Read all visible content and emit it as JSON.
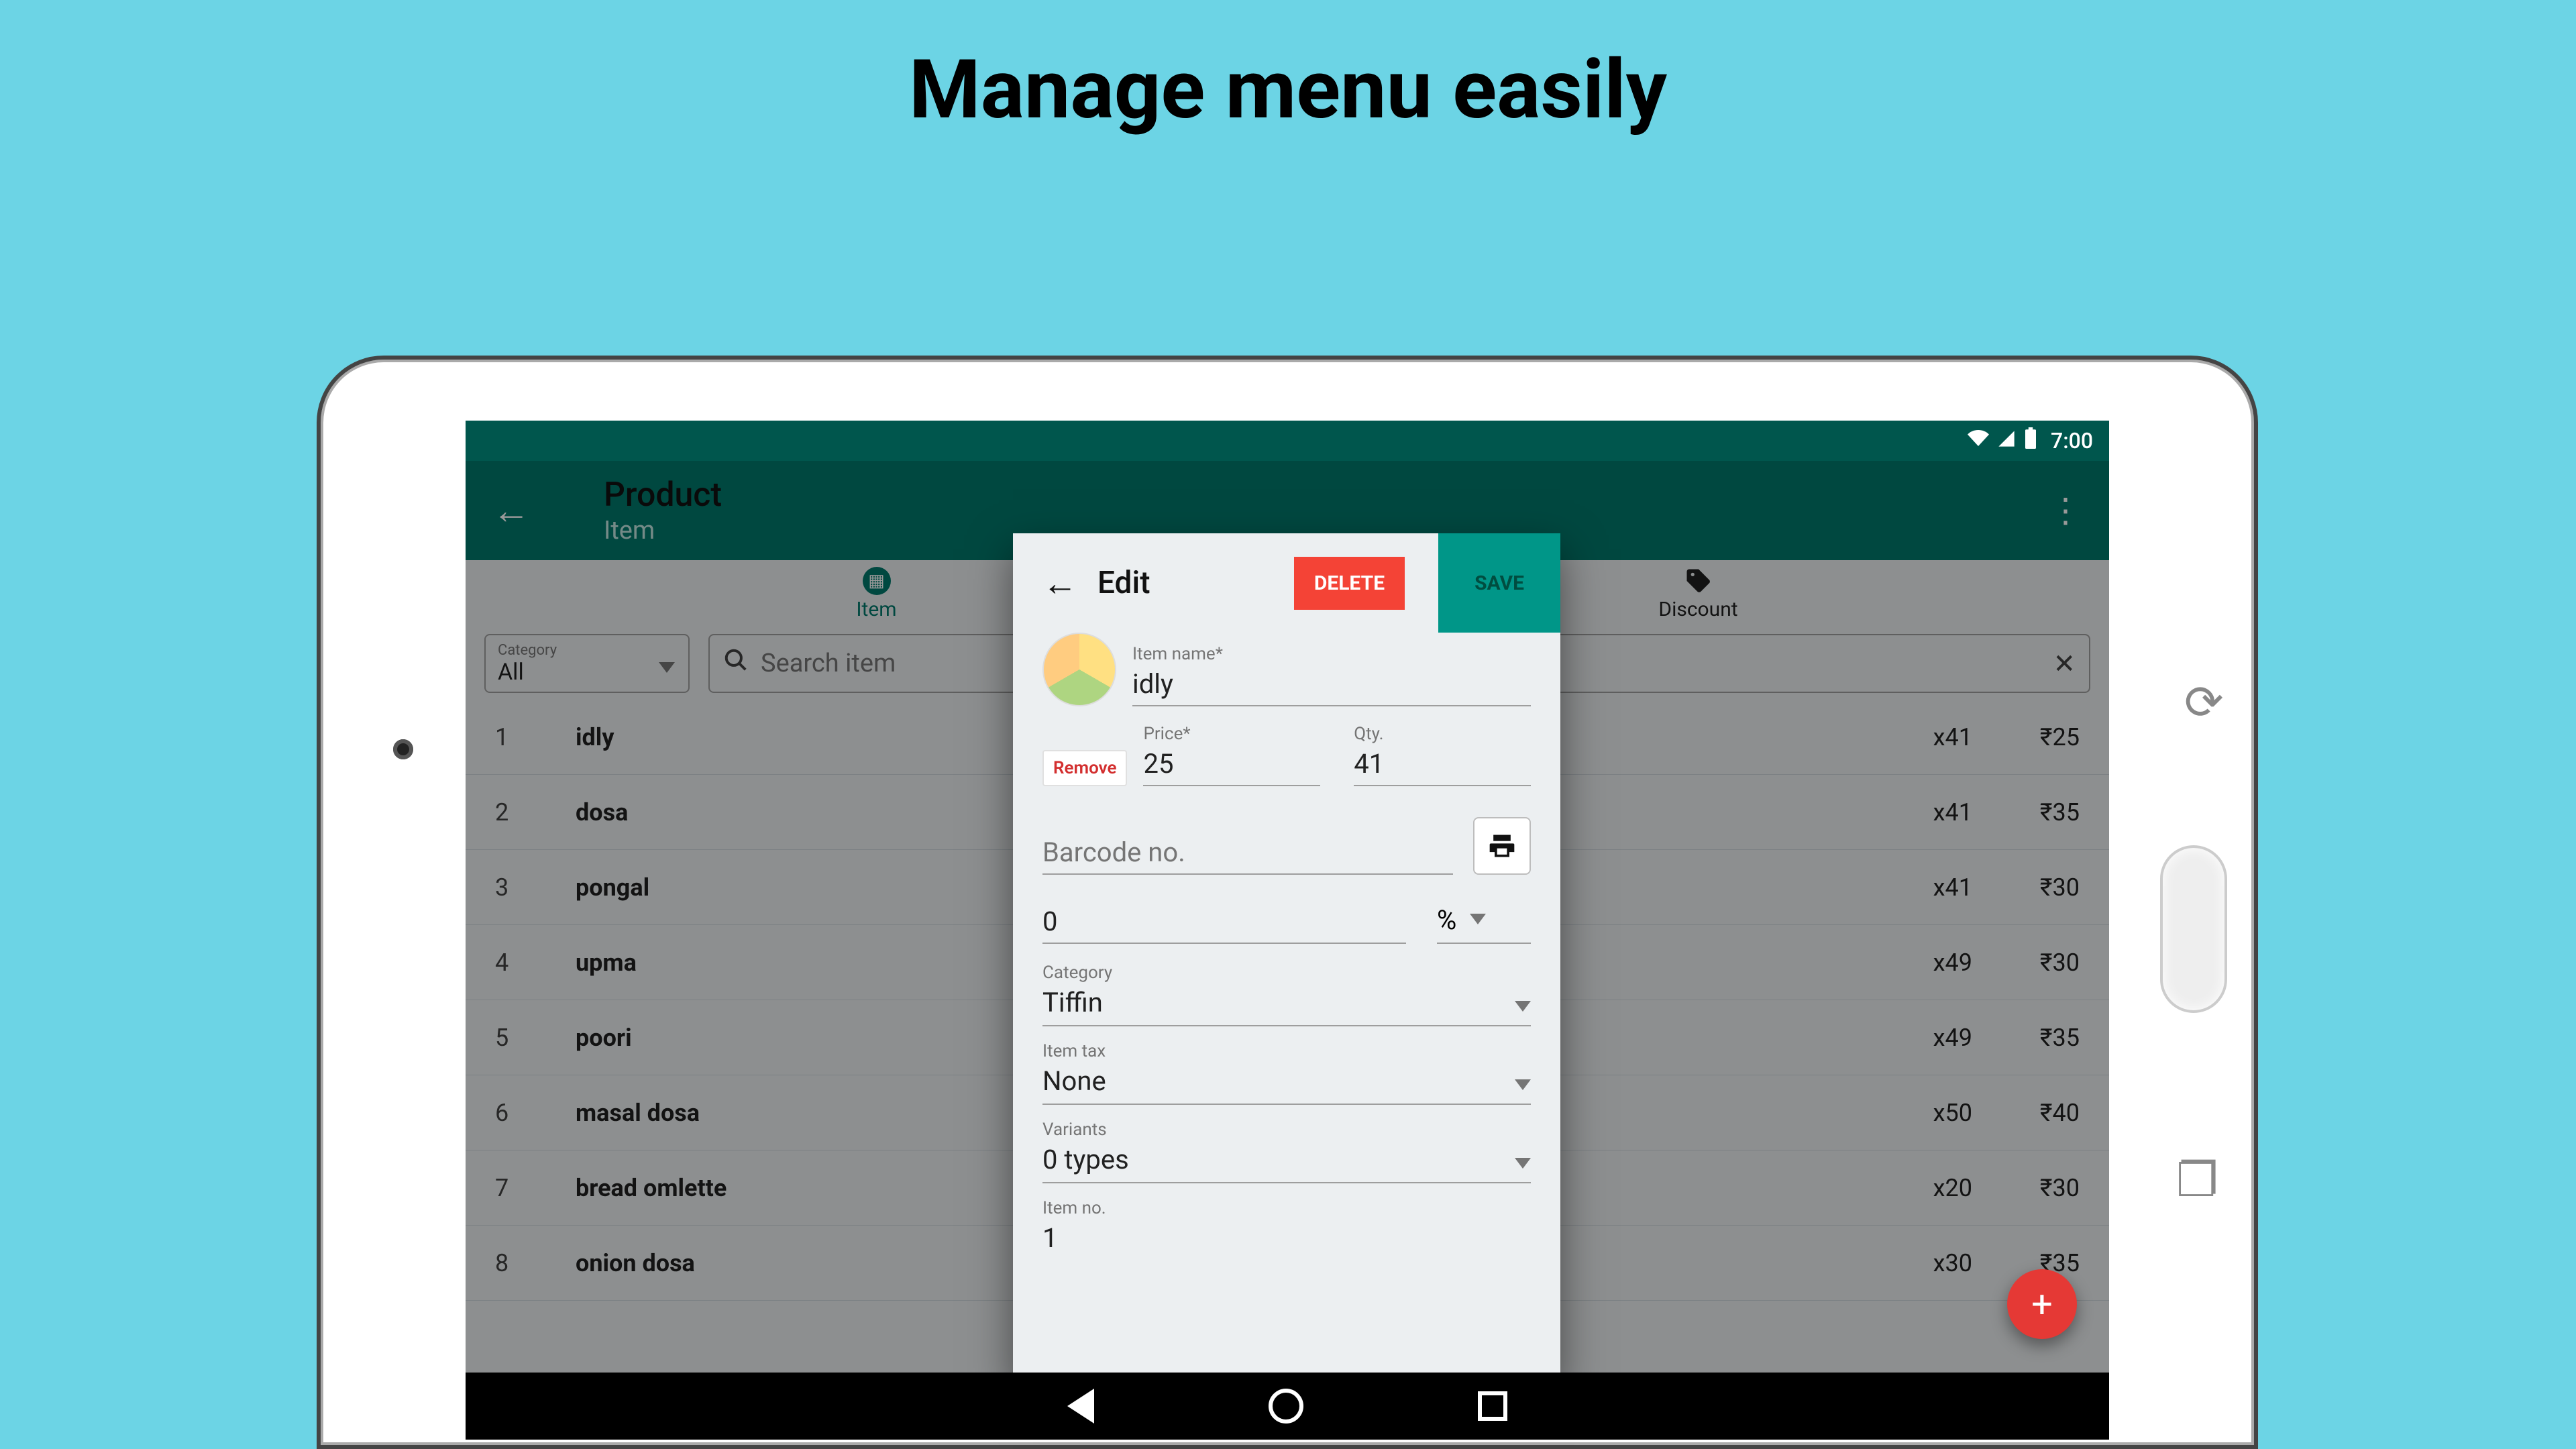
{
  "promo_title": "Manage menu easily",
  "status_bar": {
    "time": "7:00"
  },
  "app_bar": {
    "title": "Product",
    "subtitle": "Item"
  },
  "tabs": {
    "item": "Item",
    "discount": "Discount"
  },
  "category_filter": {
    "label": "Category",
    "value": "All"
  },
  "search": {
    "placeholder": "Search item"
  },
  "currency_symbol": "₹",
  "items": [
    {
      "idx": "1",
      "name": "idly",
      "qty": "x41",
      "price": "₹25"
    },
    {
      "idx": "2",
      "name": "dosa",
      "qty": "x41",
      "price": "₹35"
    },
    {
      "idx": "3",
      "name": "pongal",
      "qty": "x41",
      "price": "₹30"
    },
    {
      "idx": "4",
      "name": "upma",
      "qty": "x49",
      "price": "₹30"
    },
    {
      "idx": "5",
      "name": "poori",
      "qty": "x49",
      "price": "₹35"
    },
    {
      "idx": "6",
      "name": "masal dosa",
      "qty": "x50",
      "price": "₹40"
    },
    {
      "idx": "7",
      "name": "bread omlette",
      "qty": "x20",
      "price": "₹30"
    },
    {
      "idx": "8",
      "name": "onion dosa",
      "qty": "x30",
      "price": "₹35"
    }
  ],
  "modal": {
    "header_title": "Edit",
    "delete_label": "DELETE",
    "save_label": "SAVE",
    "item_name_label": "Item name*",
    "item_name_value": "idly",
    "remove_label": "Remove",
    "price_label": "Price*",
    "price_value": "25",
    "qty_label": "Qty.",
    "qty_value": "41",
    "barcode_placeholder": "Barcode no.",
    "discount_value": "0",
    "discount_unit": "%",
    "category_label": "Category",
    "category_value": "Tiffin",
    "item_tax_label": "Item tax",
    "item_tax_value": "None",
    "variants_label": "Variants",
    "variants_value": "0 types",
    "item_no_label": "Item no.",
    "item_no_value": "1"
  },
  "fab_label": "+"
}
